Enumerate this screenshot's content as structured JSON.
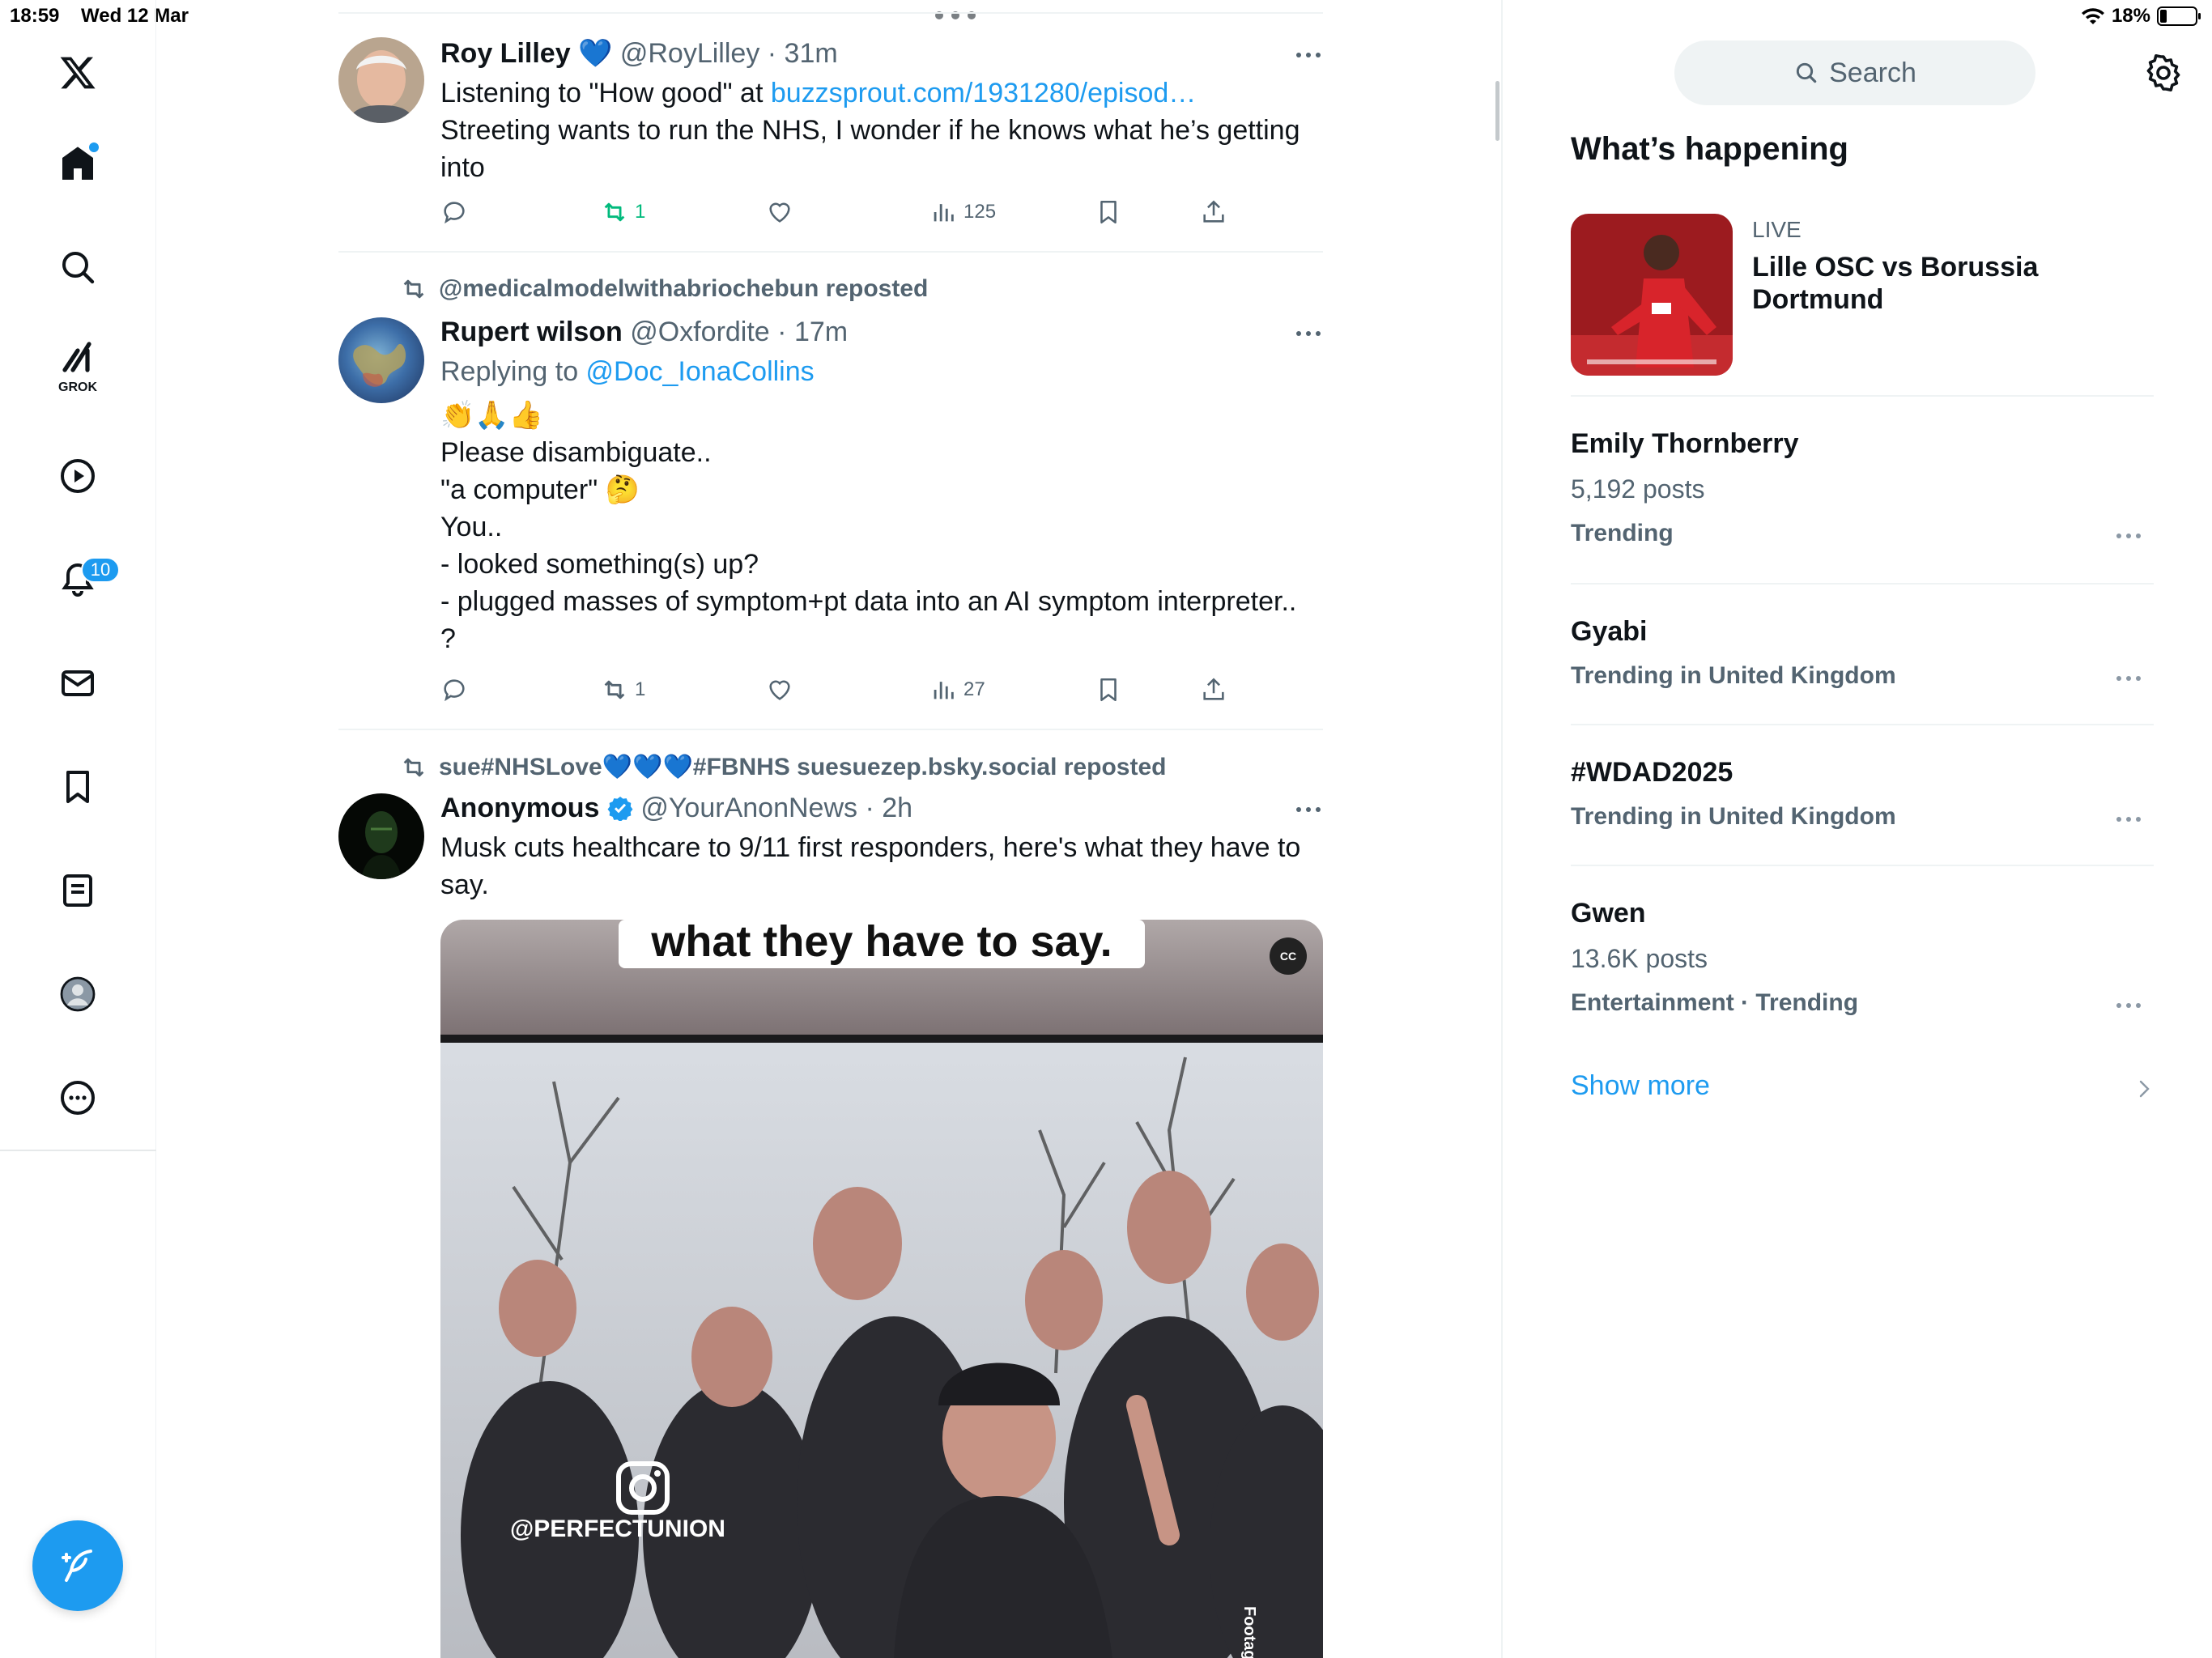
{
  "status_bar": {
    "time": "18:59",
    "date": "Wed 12 Mar",
    "battery": "18%",
    "battery_level": 0.18
  },
  "nav": {
    "notifications_badge": "10",
    "grok_label": "GROK"
  },
  "tweets": [
    {
      "name": "Roy Lilley",
      "name_emoji": "💙",
      "handle": "@RoyLilley",
      "time": "31m",
      "line1_prefix": "Listening to \"How good\" at ",
      "line1_link": "buzzsprout.com/1931280/episod…",
      "line2": "Streeting wants to run the NHS, I wonder if he knows what he’s getting into",
      "reposts": "1",
      "views": "125"
    },
    {
      "repost_by": "@medicalmodelwithabriochebun reposted",
      "name": "Rupert wilson",
      "handle": "@Oxfordite",
      "time": "17m",
      "replying_prefix": "Replying to ",
      "replying_handle": "@Doc_IonaCollins",
      "emojis": "👏🙏👍",
      "lines": [
        "Please disambiguate..",
        "\"a computer\" 🤔",
        "You..",
        "- looked something(s) up?",
        "- plugged masses of symptom+pt data into an AI  symptom interpreter..",
        "?"
      ],
      "reposts": "1",
      "views": "27"
    },
    {
      "repost_by": "sue#NHSLove💙💙💙#FBNHS suesuezep.bsky.social reposted",
      "name": "Anonymous",
      "handle": "@YourAnonNews",
      "time": "2h",
      "text": "Musk cuts healthcare to 9/11 first responders, here's what they have to say.",
      "video_caption": "what they have to say.",
      "video_watermark": "@PERFECTUNION",
      "video_side_text": "Footag",
      "cc_label": "CC"
    }
  ],
  "sidebar": {
    "search_placeholder": "Search",
    "title": "What’s happening",
    "live": {
      "label": "LIVE",
      "title": "Lille OSC vs Borussia Dortmund"
    },
    "trends": [
      {
        "name": "Emily Thornberry",
        "posts": "5,192 posts",
        "meta": "Trending"
      },
      {
        "name": "Gyabi",
        "posts": "",
        "meta": "Trending in United Kingdom"
      },
      {
        "name": "#WDAD2025",
        "posts": "",
        "meta": "Trending in United Kingdom"
      },
      {
        "name": "Gwen",
        "posts": "13.6K posts",
        "meta": "Entertainment · Trending"
      }
    ],
    "show_more": "Show more"
  },
  "colors": {
    "accent": "#1d9bf0",
    "repost_green": "#00ba7c",
    "secondary_text": "#536471"
  }
}
